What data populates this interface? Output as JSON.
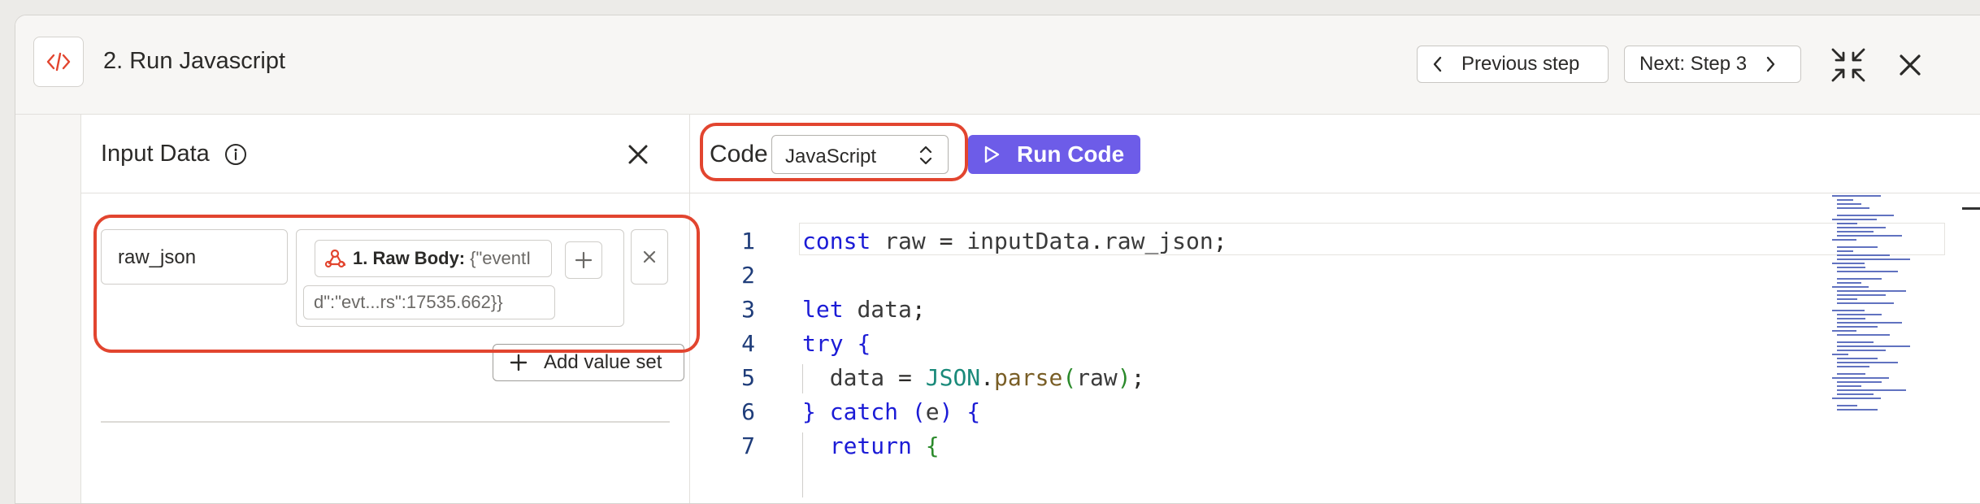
{
  "header": {
    "title": "2. Run Javascript",
    "prev_label": "Previous step",
    "next_label": "Next: Step 3"
  },
  "input_panel": {
    "title": "Input Data",
    "key": "raw_json",
    "value_pill_label": "1. Raw Body:",
    "value_pill_preview": "{\"eventI",
    "value_continuation": "d\":\"evt...rs\":17535.662}}",
    "add_value_set_label": "Add value set"
  },
  "code_panel": {
    "label": "Code",
    "language": "JavaScript",
    "run_label": "Run Code",
    "lines": [
      {
        "n": "1",
        "code": "const raw = inputData.raw_json;"
      },
      {
        "n": "2",
        "code": ""
      },
      {
        "n": "3",
        "code": "let data;"
      },
      {
        "n": "4",
        "code": "try {"
      },
      {
        "n": "5",
        "code": "  data = JSON.parse(raw);"
      },
      {
        "n": "6",
        "code": "} catch (e) {"
      },
      {
        "n": "7",
        "code": "  return {"
      }
    ]
  },
  "colors": {
    "accent": "#6d5ce8",
    "highlight": "#e2452f",
    "zapier_orange": "#e2452f"
  },
  "icons": [
    "code-icon",
    "chevron-left-icon",
    "chevron-right-icon",
    "collapse-icon",
    "close-icon",
    "info-icon",
    "webhook-icon",
    "plus-icon",
    "play-icon",
    "select-arrows-icon"
  ]
}
